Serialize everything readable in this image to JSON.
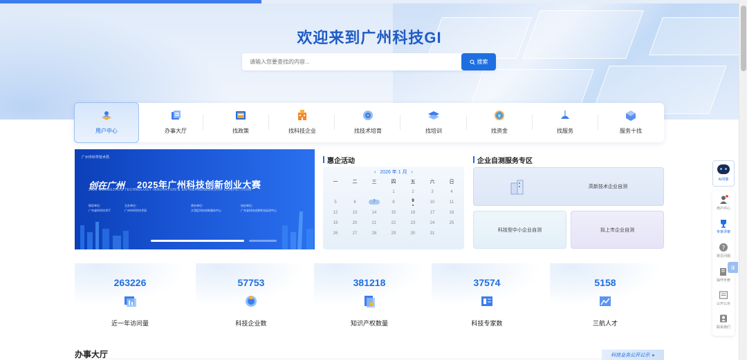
{
  "hero": {
    "title": "欢迎来到广州科技GI",
    "search_placeholder": "请输入您要查找的内容...",
    "search_button": "搜索"
  },
  "nav": {
    "items": [
      {
        "label": "用户中心",
        "icon": "user-center-icon",
        "color": "#f0a030"
      },
      {
        "label": "办事大厅",
        "icon": "service-hall-icon",
        "color": "#3d7bf0"
      },
      {
        "label": "找政策",
        "icon": "policy-icon",
        "color": "#2a8fe0"
      },
      {
        "label": "找科技企业",
        "icon": "tech-enterprise-icon",
        "color": "#f08a30"
      },
      {
        "label": "找技术培育",
        "icon": "tech-cultivation-icon",
        "color": "#3d9bf0"
      },
      {
        "label": "找培训",
        "icon": "training-icon",
        "color": "#2a7fe0"
      },
      {
        "label": "找资金",
        "icon": "funding-icon",
        "color": "#f0b030"
      },
      {
        "label": "找服务",
        "icon": "service-icon",
        "color": "#3d7bf0"
      },
      {
        "label": "服务十找",
        "icon": "ten-services-icon",
        "color": "#5a8ff0"
      }
    ]
  },
  "banner": {
    "org": "广州市科学技术局",
    "slogan": "创在广州",
    "title": "2025年广州科技创新创业大赛",
    "subtitle": "2025 GUANGZHOU TECHNOLOGY INNOVATION & ENTREPRENEURSHIP COMPETITION",
    "info": [
      {
        "k": "指导单位：",
        "v": "广东省科学技术厅"
      },
      {
        "k": "主办单位：",
        "v": "广州市科学技术局"
      },
      {
        "k": "承办单位：",
        "v": "大湾区科技创新服务中心"
      },
      {
        "k": "协办单位：",
        "v": "广东省科技成果转化促进中心"
      }
    ]
  },
  "activities": {
    "heading": "惠企活动",
    "calendar_title": "2026 年 1 月",
    "prev": "‹",
    "next": "›",
    "weekdays": [
      "一",
      "二",
      "三",
      "四",
      "五",
      "六",
      "日"
    ],
    "weeks": [
      [
        "",
        "",
        "",
        "1",
        "2",
        "3",
        "4"
      ],
      [
        "5",
        "6",
        "7",
        "8",
        "9",
        "10",
        "11"
      ],
      [
        "12",
        "13",
        "14",
        "15",
        "16",
        "17",
        "18"
      ],
      [
        "19",
        "20",
        "21",
        "22",
        "23",
        "24",
        "25"
      ],
      [
        "26",
        "27",
        "28",
        "29",
        "30",
        "31",
        ""
      ]
    ],
    "selected": "7",
    "today": "9"
  },
  "self_test": {
    "heading": "企业自测服务专区",
    "items": [
      "高新技术企业自测",
      "科技型中小企业自测",
      "拟上市企业自测"
    ]
  },
  "stats": [
    {
      "value": "263226",
      "label": "近一年访问量",
      "icon": "visits-icon"
    },
    {
      "value": "57753",
      "label": "科技企业数",
      "icon": "enterprise-count-icon"
    },
    {
      "value": "381218",
      "label": "知识产权数量",
      "icon": "ip-count-icon"
    },
    {
      "value": "37574",
      "label": "科技专家数",
      "icon": "expert-count-icon"
    },
    {
      "value": "5158",
      "label": "三航人才",
      "icon": "talent-icon"
    }
  ],
  "bottom": {
    "section_title": "办事大厅",
    "public_button": "科技业务公开公示"
  },
  "side": {
    "ai_label": "AI问答",
    "items": [
      {
        "label": "用户中心",
        "icon": "user-icon"
      },
      {
        "label": "专家评审",
        "icon": "trophy-icon"
      },
      {
        "label": "常见问题",
        "icon": "question-icon"
      },
      {
        "label": "操作手册",
        "icon": "manual-icon"
      },
      {
        "label": "公开公示",
        "icon": "notice-icon"
      },
      {
        "label": "联系我们",
        "icon": "contact-icon"
      }
    ],
    "tab_label": "课"
  }
}
